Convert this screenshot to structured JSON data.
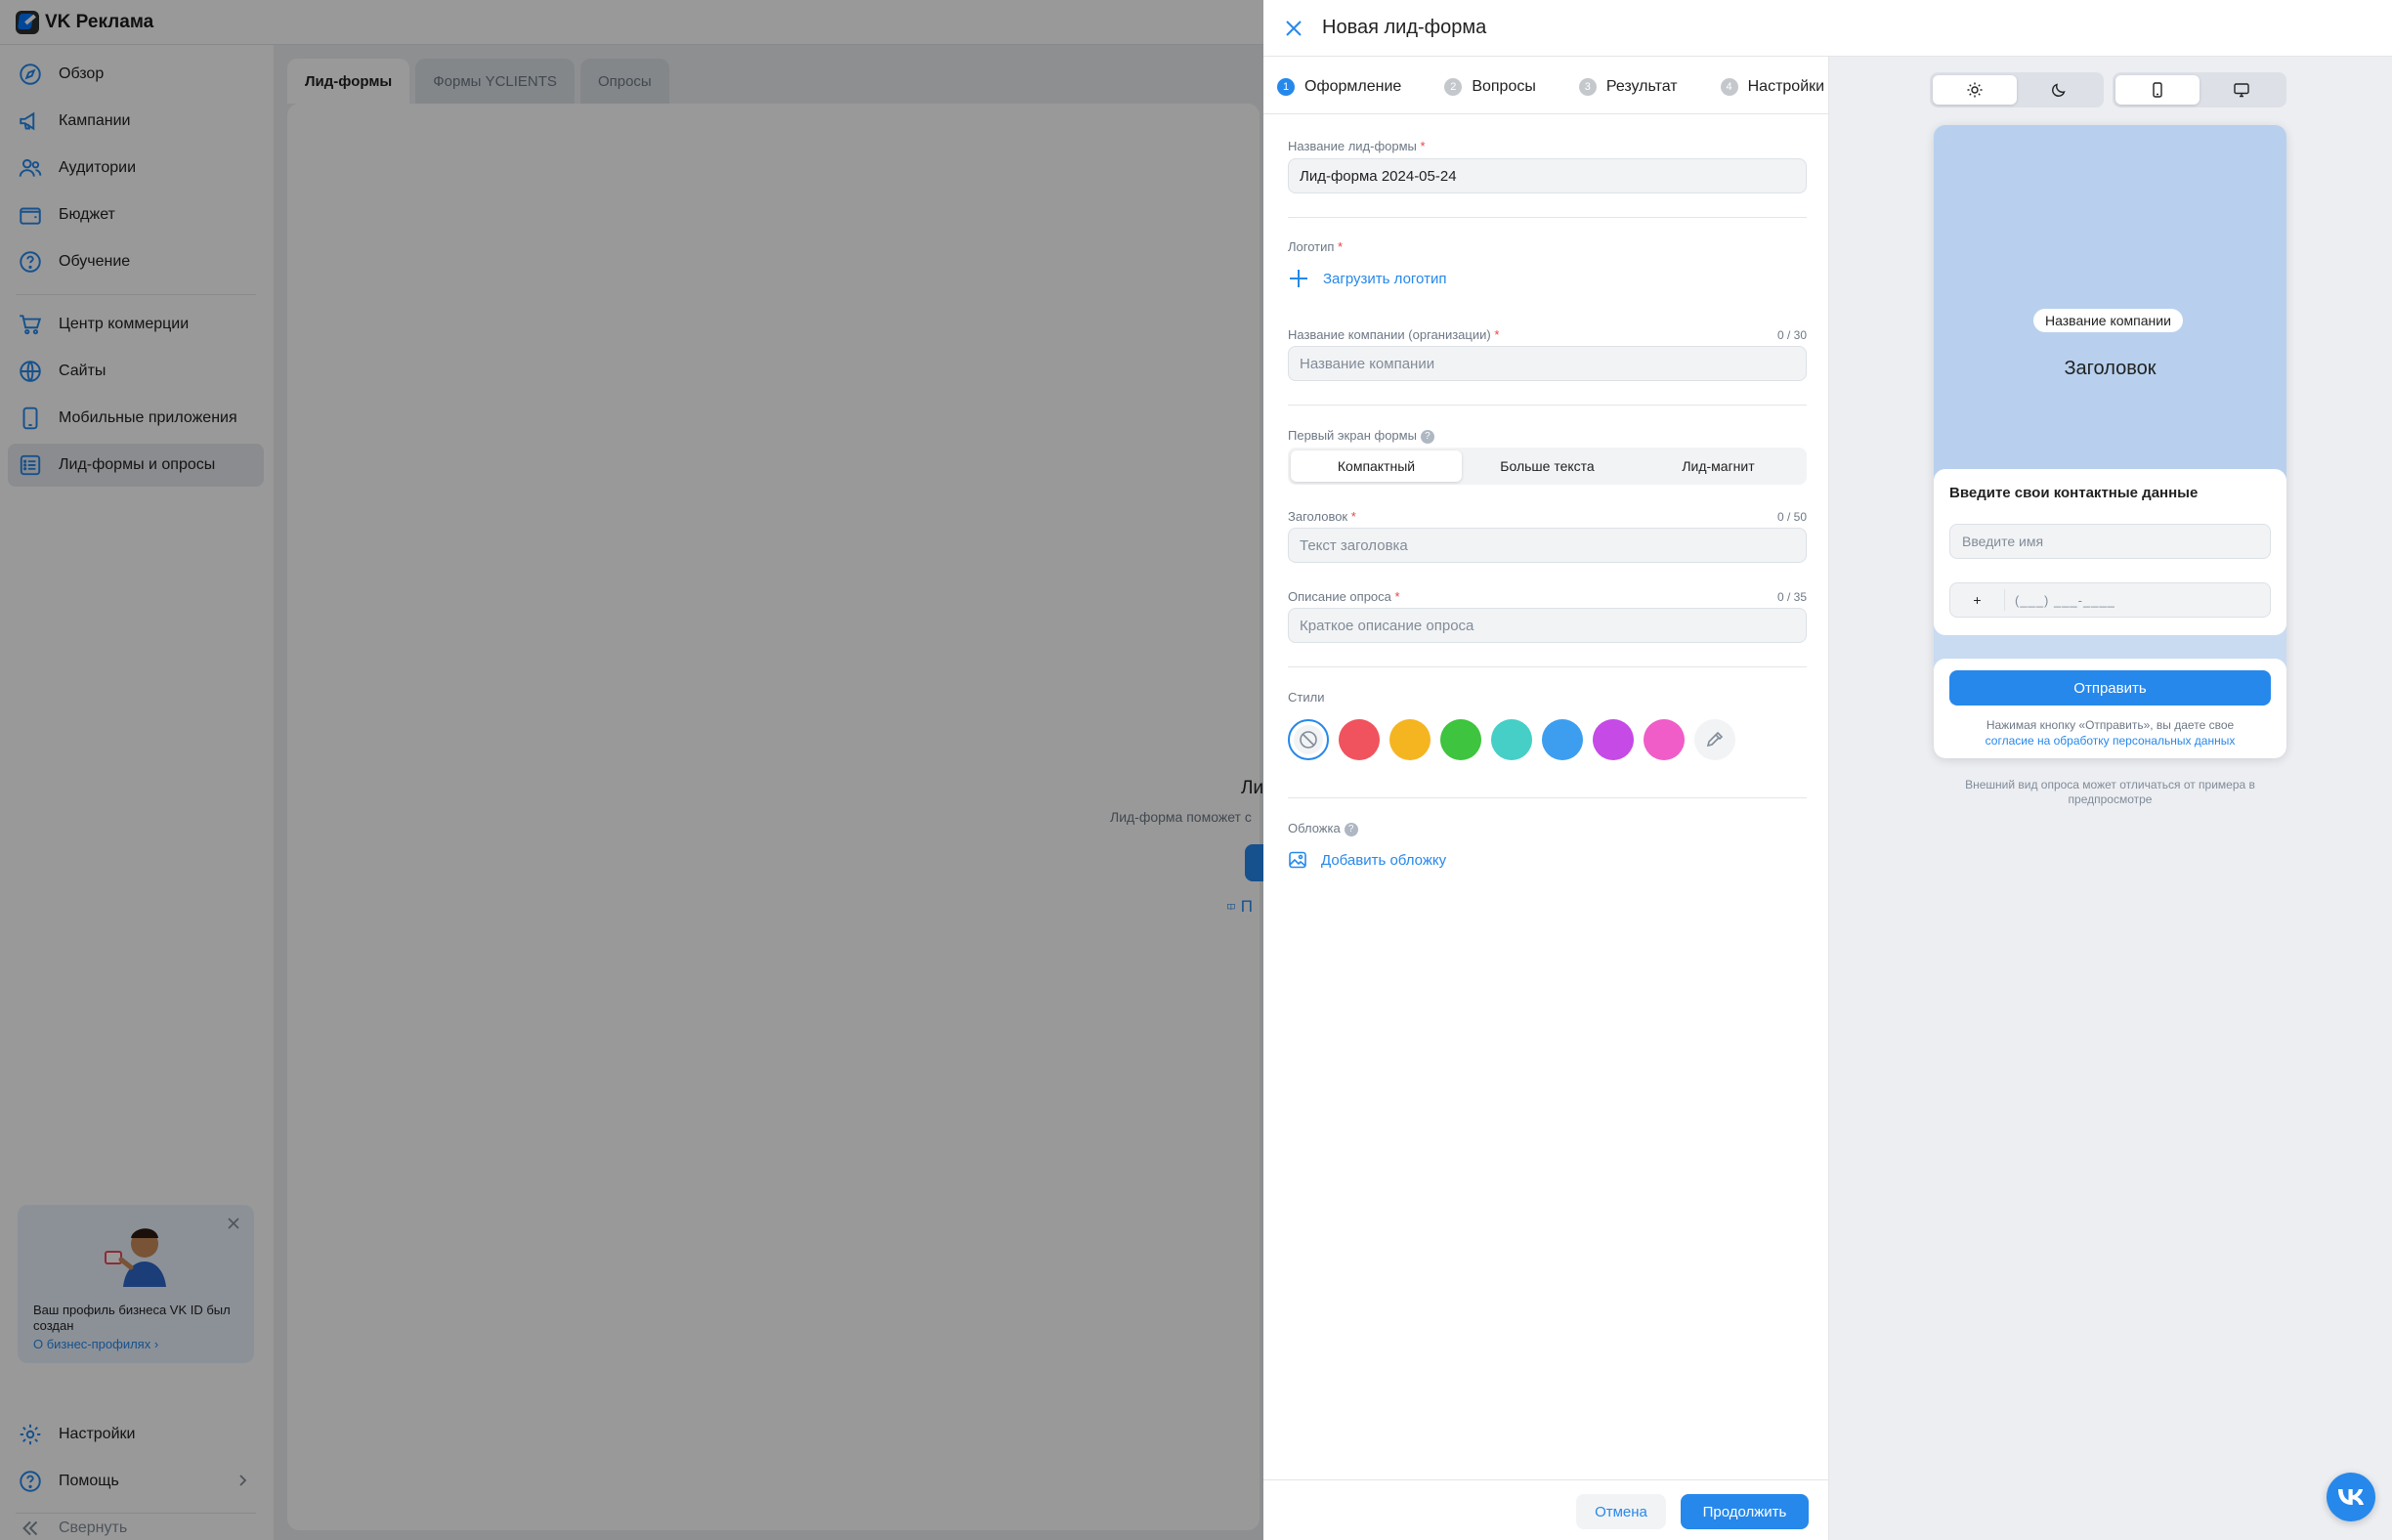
{
  "app": {
    "brand": "VK Реклама"
  },
  "sidebar": {
    "items": [
      {
        "label": "Обзор",
        "icon": "compass-icon"
      },
      {
        "label": "Кампании",
        "icon": "megaphone-icon"
      },
      {
        "label": "Аудитории",
        "icon": "users-icon"
      },
      {
        "label": "Бюджет",
        "icon": "wallet-icon"
      },
      {
        "label": "Обучение",
        "icon": "question-icon"
      },
      {
        "label": "Центр коммерции",
        "icon": "cart-icon"
      },
      {
        "label": "Сайты",
        "icon": "globe-icon"
      },
      {
        "label": "Мобильные приложения",
        "icon": "smartphone-icon"
      },
      {
        "label": "Лид-формы и опросы",
        "icon": "list-icon"
      }
    ],
    "promo": {
      "text": "Ваш профиль бизнеса VK ID был создан",
      "link": "О бизнес-профилях"
    },
    "settings": "Настройки",
    "help": "Помощь",
    "collapse": "Свернуть"
  },
  "main": {
    "tabs": [
      "Лид-формы",
      "Формы YCLIENTS",
      "Опросы"
    ],
    "empty_title": "Ли",
    "empty_sub": "Лид-форма поможет с",
    "help_text": "П"
  },
  "panel": {
    "title": "Новая лид-форма",
    "steps": [
      {
        "num": "1",
        "label": "Оформление"
      },
      {
        "num": "2",
        "label": "Вопросы"
      },
      {
        "num": "3",
        "label": "Результат"
      },
      {
        "num": "4",
        "label": "Настройки"
      }
    ],
    "form": {
      "name_label": "Название лид-формы",
      "name_value": "Лид-форма 2024-05-24",
      "logo_label": "Логотип",
      "logo_upload": "Загрузить логотип",
      "company_label": "Название компании (организации)",
      "company_counter": "0 / 30",
      "company_placeholder": "Название компании",
      "first_screen_label": "Первый экран формы",
      "first_screen_options": [
        "Компактный",
        "Больше текста",
        "Лид-магнит"
      ],
      "header_label": "Заголовок",
      "header_counter": "0 / 50",
      "header_placeholder": "Текст заголовка",
      "desc_label": "Описание опроса",
      "desc_counter": "0 / 35",
      "desc_placeholder": "Краткое описание опроса",
      "styles_label": "Стили",
      "style_colors": [
        "#f0535d",
        "#f5b521",
        "#3ec43e",
        "#46cfc6",
        "#3d9ef0",
        "#c54ae6",
        "#f05cc8"
      ],
      "cover_label": "Обложка",
      "cover_add": "Добавить обложку"
    },
    "footer": {
      "cancel": "Отмена",
      "continue": "Продолжить"
    },
    "required_mark": "*"
  },
  "preview": {
    "company_badge": "Название компании",
    "heading": "Заголовок",
    "contact_title": "Введите свои контактные данные",
    "name_placeholder": "Введите имя",
    "phone_prefix": "+",
    "phone_mask": "(___) ___-____",
    "send": "Отправить",
    "agree_text": "Нажимая кнопку «Отправить», вы даете свое",
    "agree_link": "согласие на обработку персональных данных",
    "note": "Внешний вид опроса может отличаться от примера в предпросмотре"
  }
}
